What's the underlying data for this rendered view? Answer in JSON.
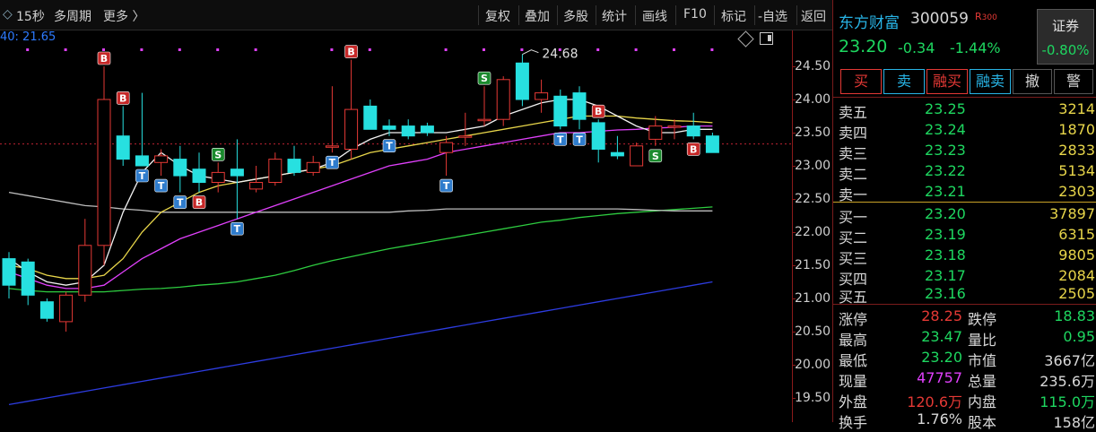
{
  "toolbar": {
    "left": [
      "15秒",
      "多周期",
      "更多 〉"
    ],
    "buttons": [
      "复权",
      "叠加",
      "多股",
      "统计",
      "画线",
      "F10",
      "标记",
      "-自选",
      "返回"
    ]
  },
  "ma_label": "40: 21.65",
  "chart_data": {
    "type": "candlestick",
    "y_ticks": [
      "24.50",
      "24.00",
      "23.50",
      "23.00",
      "22.50",
      "22.00",
      "21.50",
      "21.00",
      "20.50",
      "20.00",
      "19.50"
    ],
    "ylim": [
      19.2,
      25.0
    ],
    "max_label": "24.68",
    "candles": [
      {
        "o": 21.6,
        "h": 21.7,
        "l": 21.0,
        "c": 21.2
      },
      {
        "o": 21.55,
        "h": 21.6,
        "l": 20.9,
        "c": 21.05
      },
      {
        "o": 20.95,
        "h": 21.0,
        "l": 20.65,
        "c": 20.7
      },
      {
        "o": 20.65,
        "h": 21.1,
        "l": 20.5,
        "c": 21.05
      },
      {
        "o": 21.05,
        "h": 22.2,
        "l": 20.95,
        "c": 21.8
      },
      {
        "o": 21.8,
        "h": 24.5,
        "l": 21.5,
        "c": 24.0
      },
      {
        "o": 23.45,
        "h": 23.9,
        "l": 23.0,
        "c": 23.1
      },
      {
        "o": 23.15,
        "h": 24.1,
        "l": 23.0,
        "c": 23.0
      },
      {
        "o": 23.05,
        "h": 23.25,
        "l": 22.85,
        "c": 23.15
      },
      {
        "o": 23.1,
        "h": 23.3,
        "l": 22.6,
        "c": 22.85
      },
      {
        "o": 22.95,
        "h": 23.2,
        "l": 22.6,
        "c": 22.75
      },
      {
        "o": 22.75,
        "h": 23.05,
        "l": 22.6,
        "c": 22.9
      },
      {
        "o": 22.95,
        "h": 23.4,
        "l": 22.2,
        "c": 22.85
      },
      {
        "o": 22.65,
        "h": 23.0,
        "l": 22.6,
        "c": 22.75
      },
      {
        "o": 22.75,
        "h": 23.2,
        "l": 22.7,
        "c": 23.1
      },
      {
        "o": 23.1,
        "h": 23.3,
        "l": 22.85,
        "c": 22.9
      },
      {
        "o": 22.9,
        "h": 23.15,
        "l": 22.85,
        "c": 23.05
      },
      {
        "o": 23.3,
        "h": 24.2,
        "l": 23.2,
        "c": 23.3
      },
      {
        "o": 23.25,
        "h": 24.6,
        "l": 23.1,
        "c": 23.85
      },
      {
        "o": 23.9,
        "h": 24.0,
        "l": 23.6,
        "c": 23.55
      },
      {
        "o": 23.6,
        "h": 23.7,
        "l": 23.45,
        "c": 23.55
      },
      {
        "o": 23.6,
        "h": 23.7,
        "l": 23.4,
        "c": 23.45
      },
      {
        "o": 23.6,
        "h": 23.65,
        "l": 23.45,
        "c": 23.5
      },
      {
        "o": 23.2,
        "h": 23.45,
        "l": 22.85,
        "c": 23.35
      },
      {
        "o": 23.45,
        "h": 23.8,
        "l": 23.3,
        "c": 23.45
      },
      {
        "o": 23.7,
        "h": 24.2,
        "l": 23.6,
        "c": 23.7
      },
      {
        "o": 23.7,
        "h": 24.35,
        "l": 23.6,
        "c": 24.3
      },
      {
        "o": 24.55,
        "h": 24.68,
        "l": 23.9,
        "c": 24.0
      },
      {
        "o": 24.0,
        "h": 24.3,
        "l": 23.8,
        "c": 24.1
      },
      {
        "o": 24.05,
        "h": 24.15,
        "l": 23.55,
        "c": 23.6
      },
      {
        "o": 24.1,
        "h": 24.2,
        "l": 23.55,
        "c": 23.7
      },
      {
        "o": 23.65,
        "h": 23.7,
        "l": 23.05,
        "c": 23.25
      },
      {
        "o": 23.2,
        "h": 23.45,
        "l": 23.1,
        "c": 23.15
      },
      {
        "o": 23.0,
        "h": 23.35,
        "l": 23.0,
        "c": 23.3
      },
      {
        "o": 23.4,
        "h": 23.75,
        "l": 23.3,
        "c": 23.6
      },
      {
        "o": 23.6,
        "h": 23.7,
        "l": 23.4,
        "c": 23.6
      },
      {
        "o": 23.6,
        "h": 23.8,
        "l": 23.4,
        "c": 23.45
      },
      {
        "o": 23.45,
        "h": 23.5,
        "l": 23.2,
        "c": 23.2
      }
    ],
    "markers": [
      {
        "i": 5,
        "t": "B",
        "pos": "above"
      },
      {
        "i": 6,
        "t": "B",
        "pos": "above"
      },
      {
        "i": 7,
        "t": "T",
        "pos": "below"
      },
      {
        "i": 8,
        "t": "T",
        "pos": "below"
      },
      {
        "i": 9,
        "t": "T",
        "pos": "below"
      },
      {
        "i": 10,
        "t": "B",
        "pos": "below"
      },
      {
        "i": 11,
        "t": "S",
        "pos": "above"
      },
      {
        "i": 12,
        "t": "T",
        "pos": "below"
      },
      {
        "i": 17,
        "t": "T",
        "pos": "below"
      },
      {
        "i": 18,
        "t": "B",
        "pos": "above"
      },
      {
        "i": 20,
        "t": "T",
        "pos": "below"
      },
      {
        "i": 23,
        "t": "T",
        "pos": "below"
      },
      {
        "i": 25,
        "t": "S",
        "pos": "above"
      },
      {
        "i": 29,
        "t": "T",
        "pos": "below"
      },
      {
        "i": 30,
        "t": "T",
        "pos": "below"
      },
      {
        "i": 31,
        "t": "B",
        "pos": "above"
      },
      {
        "i": 34,
        "t": "S",
        "pos": "below"
      },
      {
        "i": 36,
        "t": "B",
        "pos": "below"
      }
    ],
    "ma_white": [
      21.6,
      21.4,
      21.25,
      21.2,
      21.25,
      21.5,
      22.3,
      22.9,
      23.2,
      23.0,
      22.85,
      22.8,
      22.75,
      22.8,
      22.85,
      22.9,
      22.95,
      23.05,
      23.25,
      23.4,
      23.5,
      23.5,
      23.5,
      23.5,
      23.55,
      23.6,
      23.75,
      23.85,
      23.95,
      24.0,
      24.0,
      23.9,
      23.75,
      23.6,
      23.5,
      23.5,
      23.55,
      23.55
    ],
    "ma_yellow": [
      21.5,
      21.45,
      21.35,
      21.3,
      21.3,
      21.35,
      21.6,
      22.0,
      22.3,
      22.45,
      22.6,
      22.7,
      22.75,
      22.8,
      22.85,
      22.9,
      22.95,
      23.0,
      23.1,
      23.2,
      23.25,
      23.3,
      23.35,
      23.4,
      23.45,
      23.5,
      23.55,
      23.6,
      23.65,
      23.7,
      23.75,
      23.75,
      23.75,
      23.72,
      23.7,
      23.68,
      23.67,
      23.65
    ],
    "ma_magenta": [
      21.4,
      21.3,
      21.2,
      21.15,
      21.15,
      21.2,
      21.4,
      21.6,
      21.75,
      21.9,
      22.0,
      22.1,
      22.2,
      22.3,
      22.4,
      22.5,
      22.6,
      22.7,
      22.8,
      22.9,
      23.0,
      23.05,
      23.1,
      23.2,
      23.25,
      23.3,
      23.35,
      23.4,
      23.45,
      23.5,
      23.5,
      23.52,
      23.54,
      23.55,
      23.57,
      23.58,
      23.6,
      23.6
    ],
    "ma_gray": [
      22.6,
      22.55,
      22.5,
      22.45,
      22.4,
      22.38,
      22.35,
      22.33,
      22.3,
      22.3,
      22.3,
      22.3,
      22.3,
      22.3,
      22.3,
      22.3,
      22.3,
      22.3,
      22.3,
      22.3,
      22.3,
      22.32,
      22.33,
      22.35,
      22.35,
      22.35,
      22.35,
      22.35,
      22.35,
      22.35,
      22.35,
      22.35,
      22.35,
      22.34,
      22.33,
      22.32,
      22.32,
      22.32
    ],
    "ma_green": [
      21.15,
      21.12,
      21.1,
      21.1,
      21.1,
      21.1,
      21.12,
      21.14,
      21.15,
      21.17,
      21.2,
      21.22,
      21.25,
      21.3,
      21.35,
      21.42,
      21.5,
      21.57,
      21.63,
      21.69,
      21.75,
      21.8,
      21.85,
      21.9,
      21.95,
      22.0,
      22.05,
      22.1,
      22.15,
      22.18,
      22.22,
      22.25,
      22.28,
      22.3,
      22.32,
      22.34,
      22.36,
      22.38
    ],
    "ma_blue": [
      19.4,
      19.45,
      19.5,
      19.55,
      19.6,
      19.65,
      19.7,
      19.75,
      19.8,
      19.85,
      19.9,
      19.95,
      20.0,
      20.05,
      20.1,
      20.15,
      20.2,
      20.25,
      20.3,
      20.35,
      20.4,
      20.45,
      20.5,
      20.55,
      20.6,
      20.65,
      20.7,
      20.75,
      20.8,
      20.85,
      20.9,
      20.95,
      21.0,
      21.05,
      21.1,
      21.15,
      21.2,
      21.25
    ]
  },
  "colors": {
    "up": "#e53935",
    "down": "#27e0e0",
    "green": "#1ed760",
    "yellow": "#e8d64a",
    "magenta": "#e040fb",
    "blue": "#2d3ce0",
    "accent": "#28b4e6"
  },
  "stock": {
    "name": "东方财富",
    "code": "300059",
    "r_tag": "R",
    "r_num": "300",
    "price": "23.20",
    "change": "-0.34",
    "change_pct": "-1.44%",
    "sector_name": "证券",
    "sector_change": "-0.80%"
  },
  "actions": [
    "买",
    "卖",
    "融买",
    "融卖",
    "撤",
    "警"
  ],
  "asks": [
    {
      "label": "卖五",
      "price": "23.25",
      "vol": "3214"
    },
    {
      "label": "卖四",
      "price": "23.24",
      "vol": "1870"
    },
    {
      "label": "卖三",
      "price": "23.23",
      "vol": "2833"
    },
    {
      "label": "卖二",
      "price": "23.22",
      "vol": "5134"
    },
    {
      "label": "卖一",
      "price": "23.21",
      "vol": "2303"
    }
  ],
  "bids": [
    {
      "label": "买一",
      "price": "23.20",
      "vol": "37897"
    },
    {
      "label": "买二",
      "price": "23.19",
      "vol": "6315"
    },
    {
      "label": "买三",
      "price": "23.18",
      "vol": "9805"
    },
    {
      "label": "买四",
      "price": "23.17",
      "vol": "2084"
    },
    {
      "label": "买五",
      "price": "23.16",
      "vol": "2505"
    }
  ],
  "stats": [
    {
      "l1": "涨停",
      "v1": "28.25",
      "c1": "#e53935",
      "l2": "跌停",
      "v2": "18.83",
      "c2": "#1ed760"
    },
    {
      "l1": "最高",
      "v1": "23.47",
      "c1": "#1ed760",
      "l2": "量比",
      "v2": "0.95",
      "c2": "#1ed760"
    },
    {
      "l1": "最低",
      "v1": "23.20",
      "c1": "#1ed760",
      "l2": "市值",
      "v2": "3667亿",
      "c2": "#d8d8d8"
    },
    {
      "l1": "现量",
      "v1": "47757",
      "c1": "#e040fb",
      "l2": "总量",
      "v2": "235.6万",
      "c2": "#d8d8d8"
    },
    {
      "l1": "外盘",
      "v1": "120.6万",
      "c1": "#e53935",
      "l2": "内盘",
      "v2": "115.0万",
      "c2": "#1ed760"
    },
    {
      "l1": "换手",
      "v1": "1.76%",
      "c1": "#d8d8d8",
      "l2": "股本",
      "v2": "158亿",
      "c2": "#d8d8d8"
    }
  ]
}
